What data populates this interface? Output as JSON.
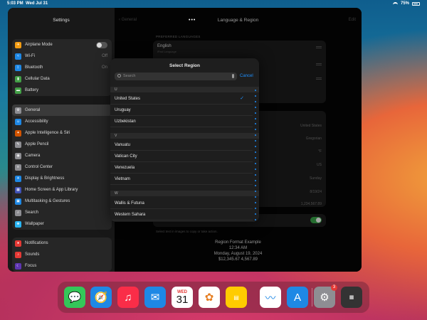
{
  "status": {
    "time": "5:03 PM",
    "date": "Wed Jul 31",
    "battery": "75%"
  },
  "sidebar": {
    "title": "Settings",
    "group1": [
      {
        "label": "Airplane Mode",
        "icon": "airplane-icon",
        "color": "#f39c12",
        "value": ""
      },
      {
        "label": "Wi-Fi",
        "icon": "wifi-icon",
        "color": "#1e88e5",
        "value": "Off"
      },
      {
        "label": "Bluetooth",
        "icon": "bluetooth-icon",
        "color": "#1e88e5",
        "value": "On"
      },
      {
        "label": "Cellular Data",
        "icon": "cellular-icon",
        "color": "#43a047",
        "value": ""
      },
      {
        "label": "Battery",
        "icon": "battery-icon",
        "color": "#43a047",
        "value": ""
      }
    ],
    "group2": [
      {
        "label": "General",
        "icon": "gear-icon",
        "color": "#8e8e93"
      },
      {
        "label": "Accessibility",
        "icon": "accessibility-icon",
        "color": "#1e88e5"
      },
      {
        "label": "Apple Intelligence & Siri",
        "icon": "siri-icon",
        "color": "#d35400"
      },
      {
        "label": "Apple Pencil",
        "icon": "pencil-icon",
        "color": "#8e8e93"
      },
      {
        "label": "Camera",
        "icon": "camera-icon",
        "color": "#8e8e93"
      },
      {
        "label": "Control Center",
        "icon": "control-center-icon",
        "color": "#8e8e93"
      },
      {
        "label": "Display & Brightness",
        "icon": "brightness-icon",
        "color": "#1e88e5"
      },
      {
        "label": "Home Screen & App Library",
        "icon": "home-screen-icon",
        "color": "#3f51b5"
      },
      {
        "label": "Multitasking & Gestures",
        "icon": "multitasking-icon",
        "color": "#1e88e5"
      },
      {
        "label": "Search",
        "icon": "search-icon",
        "color": "#8e8e93"
      },
      {
        "label": "Wallpaper",
        "icon": "wallpaper-icon",
        "color": "#29b6f6"
      }
    ],
    "group3": [
      {
        "label": "Notifications",
        "icon": "notifications-icon",
        "color": "#e53935"
      },
      {
        "label": "Sounds",
        "icon": "sounds-icon",
        "color": "#e53935"
      },
      {
        "label": "Focus",
        "icon": "focus-icon",
        "color": "#5e35b1"
      }
    ]
  },
  "main": {
    "back_label": "General",
    "title": "Language & Region",
    "edit_label": "Edit",
    "preferred_header": "PREFERRED LANGUAGES",
    "language_name": "English",
    "language_sub": "iPad Language",
    "region_values": [
      "United States",
      "Gregorian",
      "°F",
      "US",
      "Sunday",
      "8/19/24",
      "1,234,567.89"
    ],
    "note": "Select text in images to copy or take action.",
    "example_title": "Region Format Example",
    "example_time": "12:34 AM",
    "example_date": "Monday, August 19, 2024",
    "example_numbers": "$12,345.67     4,567.89"
  },
  "modal": {
    "title": "Select Region",
    "search_placeholder": "Search",
    "cancel_label": "Cancel",
    "sections": [
      {
        "letter": "U",
        "items": [
          "United States",
          "Uruguay",
          "Uzbekistan"
        ]
      },
      {
        "letter": "V",
        "items": [
          "Vanuatu",
          "Vatican City",
          "Venezuela",
          "Vietnam"
        ]
      },
      {
        "letter": "W",
        "items": [
          "Wallis & Futuna",
          "Western Sahara"
        ]
      }
    ],
    "selected": "United States"
  },
  "dock": {
    "apps": [
      {
        "name": "Messages",
        "icon": "messages-icon",
        "color": "#34c759"
      },
      {
        "name": "Safari",
        "icon": "safari-icon",
        "color": "#1e88e5"
      },
      {
        "name": "Music",
        "icon": "music-icon",
        "color": "#fa2d48"
      },
      {
        "name": "Mail",
        "icon": "mail-icon",
        "color": "#1e88e5"
      },
      {
        "name": "Calendar",
        "icon": "calendar-icon",
        "color": "#ffffff",
        "weekday": "WED",
        "day": "31"
      },
      {
        "name": "Photos",
        "icon": "photos-icon",
        "color": "#ffffff"
      },
      {
        "name": "Notes",
        "icon": "notes-icon",
        "color": "#ffcc00"
      },
      {
        "name": "Freeform",
        "icon": "freeform-icon",
        "color": "#ffffff"
      },
      {
        "name": "App Store",
        "icon": "app-store-icon",
        "color": "#1e88e5"
      },
      {
        "name": "Settings",
        "icon": "settings-icon",
        "color": "#8e8e93",
        "badge": "3"
      },
      {
        "name": "App Library",
        "icon": "app-library-icon",
        "color": "#333333"
      }
    ]
  }
}
